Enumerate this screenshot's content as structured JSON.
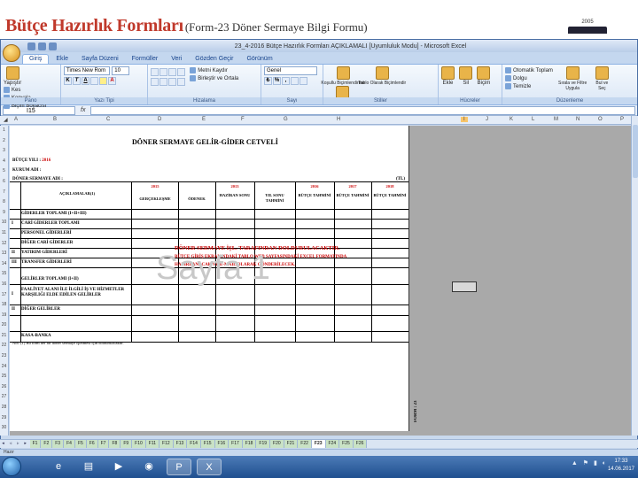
{
  "slide": {
    "title": "Bütçe Hazırlık Formları",
    "subtitle": "(Form-23 Döner Sermaye Bilgi Formu)",
    "logo_text": "2005"
  },
  "window": {
    "title": "23_4-2016 Bütçe Hazırlık Formları AÇIKLAMALI [Uyumluluk Modu] - Microsoft Excel"
  },
  "ribbon": {
    "tabs": [
      "Giriş",
      "Ekle",
      "Sayfa Düzeni",
      "Formüller",
      "Veri",
      "Gözden Geçir",
      "Görünüm"
    ],
    "active_tab": "Giriş",
    "paste_label": "Yapıştır",
    "cut_label": "Kes",
    "copy_label": "Kopyala",
    "format_painter_label": "Biçim Boyacısı",
    "font_name": "Times New Rom",
    "font_size": "10",
    "wrap_text_label": "Metni Kaydır",
    "merge_label": "Birleştir ve Ortala",
    "number_format": "Genel",
    "cond_format_label": "Koşullu Biçimlendirme",
    "table_format_label": "Tablo Olarak Biçimlendir",
    "cell_styles_label": "Hücre Stilleri",
    "insert_label": "Ekle",
    "delete_label": "Sil",
    "format_label": "Biçim",
    "autosum_label": "Otomatik Toplam",
    "fill_label": "Dolgu",
    "clear_label": "Temizle",
    "sort_label": "Sırala ve Filtre Uygula",
    "find_label": "Bul ve Seç",
    "groups": [
      "Pano",
      "Yazı Tipi",
      "Hizalama",
      "Sayı",
      "Stiller",
      "Hücreler",
      "Düzenleme"
    ]
  },
  "formula_bar": {
    "name_box": "I15",
    "fx": "fx",
    "formula": ""
  },
  "columns": [
    "A",
    "B",
    "C",
    "D",
    "E",
    "F",
    "G",
    "H",
    "I",
    "J",
    "K",
    "L",
    "M",
    "N",
    "O",
    "P",
    "Q",
    "R",
    "S"
  ],
  "selected_column": "I",
  "rows": [
    "1",
    "2",
    "3",
    "4",
    "5",
    "6",
    "7",
    "8",
    "9",
    "10",
    "11",
    "12",
    "13",
    "14",
    "15",
    "16",
    "17",
    "18",
    "19",
    "20",
    "21",
    "22",
    "23",
    "24",
    "25",
    "26",
    "27",
    "28",
    "29",
    "30"
  ],
  "document": {
    "title": "DÖNER SERMAYE GELİR-GİDER CETVELİ",
    "budget_year_label": "BÜTÇE YILI :",
    "budget_year_value": "2016",
    "institution_label": "KURUM ADI :",
    "fund_label": "DÖNER SERMAYE ADI :",
    "currency": "(TL)",
    "col_explanations": "AÇIKLAMALAR(1)",
    "year_2015": "2015",
    "year_2013": "2013",
    "year_2016": "2016",
    "year_2017": "2017",
    "year_2018": "2018",
    "col_realization": "GERÇEKLEŞME",
    "col_allowance": "ÖDENEK",
    "col_june_end": "HAZİRAN SONU",
    "col_year_end": "YIL SONU TAHMİNİ",
    "col_budget_est_1": "BÜTÇE TAHMİNİ",
    "col_budget_est_2": "BÜTÇE TAHMİNİ",
    "col_budget_est_3": "BÜTÇE TAHMİNİ",
    "rows": [
      {
        "num": "",
        "label": "GİDERLER TOPLAMI (I+II+III)"
      },
      {
        "num": "I",
        "label": "CARİ GİDERLER TOPLAMI"
      },
      {
        "num": "",
        "label": "PERSONEL GİDERLERİ"
      },
      {
        "num": "",
        "label": "DİĞER CARİ GİDERLER"
      },
      {
        "num": "II",
        "label": "YATIRIM GİDERLERİ"
      },
      {
        "num": "III",
        "label": "TRANSFER GİDERLERİ"
      },
      {
        "num": "",
        "label": "GELİRLER TOPLAMI (I+II)"
      },
      {
        "num": "I",
        "label": "FAALİYET ALANI İLE İLGİLİ İŞ VE HİZMETLER KARŞILIĞI ELDE EDİLEN GELİRLER"
      },
      {
        "num": "II",
        "label": "DİĞER GELİRLER"
      },
      {
        "num": "",
        "label": "KASA-BANKA"
      }
    ],
    "warning_1": "DÖNER SERMAYE İŞL. TARAFINDAN DOLDURULACAKTIR.",
    "warning_2": "BÜTÇE GİRİŞ EKRANINDAKİ TABLO WEB SAYFASINDAKİ EXCEL FORMATINDA",
    "warning_3": "HAZIRLANACAK VE E-MAİL OLARAK GÖNDERİLECEK.",
    "note": "Not: (1) Bu form her bir döner sermaye işletmesi için doldurulacaktır.",
    "watermark": "Sayfa 1",
    "side_text": "FORM : 23"
  },
  "sheet_tabs": [
    "F1",
    "F2",
    "F3",
    "F4",
    "F5",
    "F6",
    "F7",
    "F8",
    "F9",
    "F10",
    "F11",
    "F12",
    "F13",
    "F14",
    "F15",
    "F16",
    "F17",
    "F18",
    "F19",
    "F20",
    "F21",
    "F22",
    "F23",
    "F24",
    "F25",
    "F26"
  ],
  "active_sheet": "F23",
  "status": "Hazır",
  "taskbar": {
    "time": "17:33",
    "date": "14.06.2017"
  }
}
